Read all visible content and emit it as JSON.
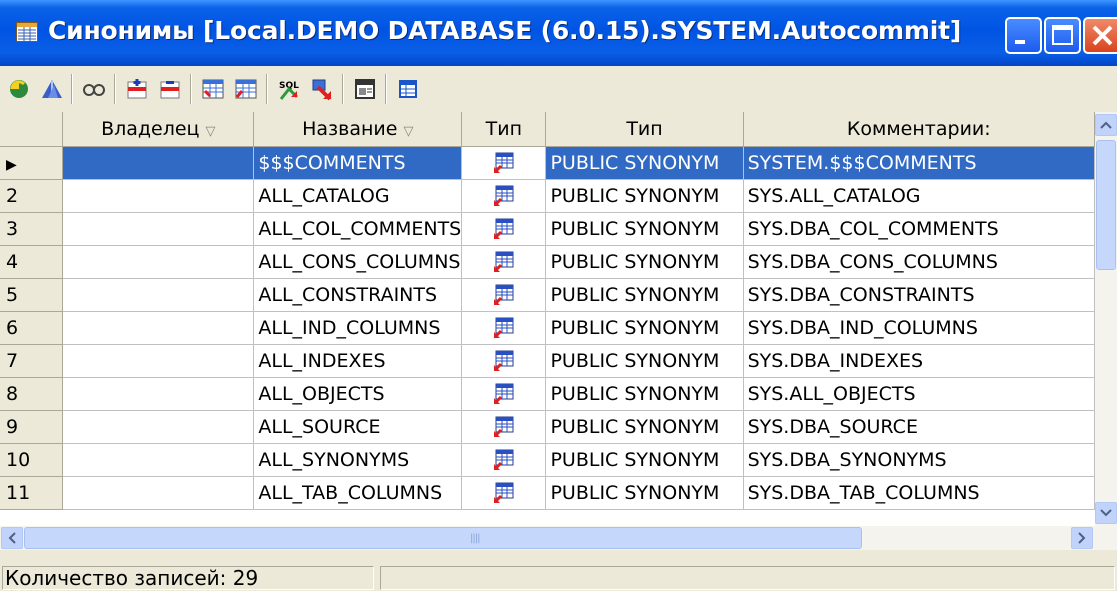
{
  "window": {
    "title": "Синонимы [Local.DEMO DATABASE (6.0.15).SYSTEM.Autocommit]"
  },
  "toolbar": {
    "buttons": [
      "refresh-icon",
      "filter-icon",
      "find-icon",
      "add-row-icon",
      "delete-row-icon",
      "grid-export-icon",
      "grid-import-icon",
      "sql-icon",
      "drop-icon",
      "properties-icon",
      "columns-icon"
    ]
  },
  "grid": {
    "columns": [
      {
        "label": "Владелец",
        "sortable": true
      },
      {
        "label": "Название",
        "sortable": true
      },
      {
        "label": "Тип",
        "sortable": false
      },
      {
        "label": "Тип",
        "sortable": false
      },
      {
        "label": "Комментарии:",
        "sortable": false
      }
    ],
    "sort_glyph": "▽",
    "current_row_glyph": "▶",
    "rows": [
      {
        "num": "",
        "owner": "",
        "name": "$$$COMMENTS",
        "type": "PUBLIC SYNONYM",
        "comment": "SYSTEM.$$$COMMENTS",
        "selected": true
      },
      {
        "num": "2",
        "owner": "",
        "name": "ALL_CATALOG",
        "type": "PUBLIC SYNONYM",
        "comment": "SYS.ALL_CATALOG"
      },
      {
        "num": "3",
        "owner": "",
        "name": "ALL_COL_COMMENTS",
        "type": "PUBLIC SYNONYM",
        "comment": "SYS.DBA_COL_COMMENTS"
      },
      {
        "num": "4",
        "owner": "",
        "name": "ALL_CONS_COLUMNS",
        "type": "PUBLIC SYNONYM",
        "comment": "SYS.DBA_CONS_COLUMNS"
      },
      {
        "num": "5",
        "owner": "",
        "name": "ALL_CONSTRAINTS",
        "type": "PUBLIC SYNONYM",
        "comment": "SYS.DBA_CONSTRAINTS"
      },
      {
        "num": "6",
        "owner": "",
        "name": "ALL_IND_COLUMNS",
        "type": "PUBLIC SYNONYM",
        "comment": "SYS.DBA_IND_COLUMNS"
      },
      {
        "num": "7",
        "owner": "",
        "name": "ALL_INDEXES",
        "type": "PUBLIC SYNONYM",
        "comment": "SYS.DBA_INDEXES"
      },
      {
        "num": "8",
        "owner": "",
        "name": "ALL_OBJECTS",
        "type": "PUBLIC SYNONYM",
        "comment": "SYS.ALL_OBJECTS"
      },
      {
        "num": "9",
        "owner": "",
        "name": "ALL_SOURCE",
        "type": "PUBLIC SYNONYM",
        "comment": "SYS.DBA_SOURCE"
      },
      {
        "num": "10",
        "owner": "",
        "name": "ALL_SYNONYMS",
        "type": "PUBLIC SYNONYM",
        "comment": "SYS.DBA_SYNONYMS"
      },
      {
        "num": "11",
        "owner": "",
        "name": "ALL_TAB_COLUMNS",
        "type": "PUBLIC SYNONYM",
        "comment": "SYS.DBA_TAB_COLUMNS"
      }
    ]
  },
  "statusbar": {
    "record_count": "Количество записей: 29"
  },
  "colors": {
    "selection": "#316ac5",
    "titlebar": "#0054e3"
  }
}
